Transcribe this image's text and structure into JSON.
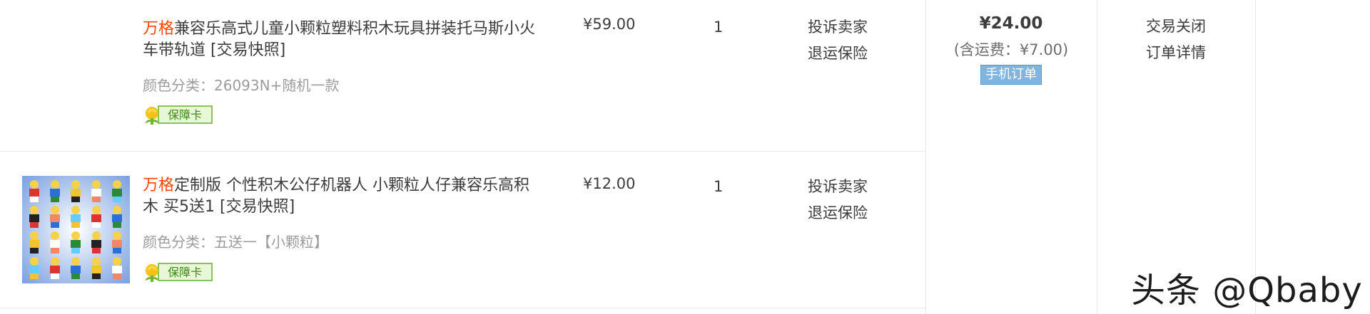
{
  "orders": [
    {
      "brand": "万格",
      "title": "兼容乐高式儿童小颗粒塑料积木玩具拼装托马斯小火车带轨道 [交易快照]",
      "spec": "颜色分类：26093N+随机一款",
      "badge": "保障卡",
      "price": "¥59.00",
      "qty": "1",
      "actions": [
        "投诉卖家",
        "退运保险"
      ]
    },
    {
      "brand": "万格",
      "title": "定制版 个性积木公仔机器人 小颗粒人仔兼容乐高积木 买5送1 [交易快照]",
      "spec": "颜色分类：五送一【小颗粒】",
      "badge": "保障卡",
      "price": "¥12.00",
      "qty": "1",
      "actions": [
        "投诉卖家",
        "退运保险"
      ]
    }
  ],
  "summary": {
    "total": "¥24.00",
    "shipping": "(含运费：¥7.00)",
    "mobile_tag": "手机订单"
  },
  "status": {
    "state": "交易关闭",
    "detail_link": "订单详情"
  },
  "watermark": "头条 @Qbaby",
  "colors": {
    "brand": "#ff4400",
    "mobile_tag": "#7fb5de"
  }
}
